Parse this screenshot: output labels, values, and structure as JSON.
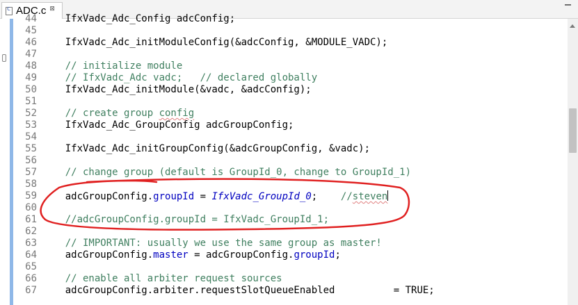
{
  "editor": {
    "tab": {
      "label": "ADC.c",
      "close_glyph": "⊠"
    },
    "accent_colors": {
      "comment": "#3f7f5f",
      "field": "#0000c0",
      "annotation": "#e02020",
      "change_bar": "#8fb8e8"
    },
    "lines": [
      {
        "num": "44",
        "parts": [
          {
            "t": "    IfxVadc_Adc_Config adcConfig;",
            "c": ""
          }
        ]
      },
      {
        "num": "45",
        "parts": []
      },
      {
        "num": "46",
        "parts": [
          {
            "t": "    IfxVadc_Adc_initModuleConfig(&adcConfig, &MODULE_VADC);",
            "c": ""
          }
        ]
      },
      {
        "num": "47",
        "parts": []
      },
      {
        "num": "48",
        "parts": [
          {
            "t": "    // initialize module",
            "c": "cmt"
          }
        ]
      },
      {
        "num": "49",
        "parts": [
          {
            "t": "    // IfxVadc_Adc vadc;   // declared globally",
            "c": "cmt"
          }
        ]
      },
      {
        "num": "50",
        "parts": [
          {
            "t": "    IfxVadc_Adc_initModule(&vadc, &adcConfig);",
            "c": ""
          }
        ]
      },
      {
        "num": "51",
        "parts": []
      },
      {
        "num": "52",
        "parts": [
          {
            "t": "    // create group ",
            "c": "cmt"
          },
          {
            "t": "config",
            "c": "cmt sq"
          }
        ]
      },
      {
        "num": "53",
        "parts": [
          {
            "t": "    IfxVadc_Adc_GroupConfig adcGroupConfig;",
            "c": ""
          }
        ]
      },
      {
        "num": "54",
        "parts": []
      },
      {
        "num": "55",
        "parts": [
          {
            "t": "    IfxVadc_Adc_initGroupConfig(&adcGroupConfig, &vadc);",
            "c": ""
          }
        ]
      },
      {
        "num": "56",
        "parts": []
      },
      {
        "num": "57",
        "parts": [
          {
            "t": "    // change group (default is GroupId_0, change to GroupId_1)",
            "c": "cmt"
          }
        ]
      },
      {
        "num": "58",
        "parts": []
      },
      {
        "num": "59",
        "parts": [
          {
            "t": "    adcGroupConfig.",
            "c": ""
          },
          {
            "t": "groupId",
            "c": "fld"
          },
          {
            "t": " = ",
            "c": ""
          },
          {
            "t": "IfxVadc_GroupId_0",
            "c": "en"
          },
          {
            "t": ";    ",
            "c": ""
          },
          {
            "t": "//",
            "c": "cmt"
          },
          {
            "t": "steven",
            "c": "cmt sq"
          },
          {
            "t": "",
            "c": "caret"
          }
        ]
      },
      {
        "num": "60",
        "parts": []
      },
      {
        "num": "61",
        "parts": [
          {
            "t": "    //adcGroupConfig.groupId = IfxVadc_GroupId_1;",
            "c": "cmt"
          }
        ]
      },
      {
        "num": "62",
        "parts": []
      },
      {
        "num": "63",
        "parts": [
          {
            "t": "    // IMPORTANT: usually we use the same group as master!",
            "c": "cmt"
          }
        ]
      },
      {
        "num": "64",
        "parts": [
          {
            "t": "    adcGroupConfig.",
            "c": ""
          },
          {
            "t": "master",
            "c": "fld"
          },
          {
            "t": " = adcGroupConfig.",
            "c": ""
          },
          {
            "t": "groupId",
            "c": "fld"
          },
          {
            "t": ";",
            "c": ""
          }
        ]
      },
      {
        "num": "65",
        "parts": []
      },
      {
        "num": "66",
        "parts": [
          {
            "t": "    // enable all arbiter request sources",
            "c": "cmt"
          }
        ]
      },
      {
        "num": "67",
        "parts": [
          {
            "t": "    adcGroupConfig.arbiter.requestSlotQueueEnabled          = TRUE;",
            "c": ""
          }
        ]
      }
    ]
  }
}
